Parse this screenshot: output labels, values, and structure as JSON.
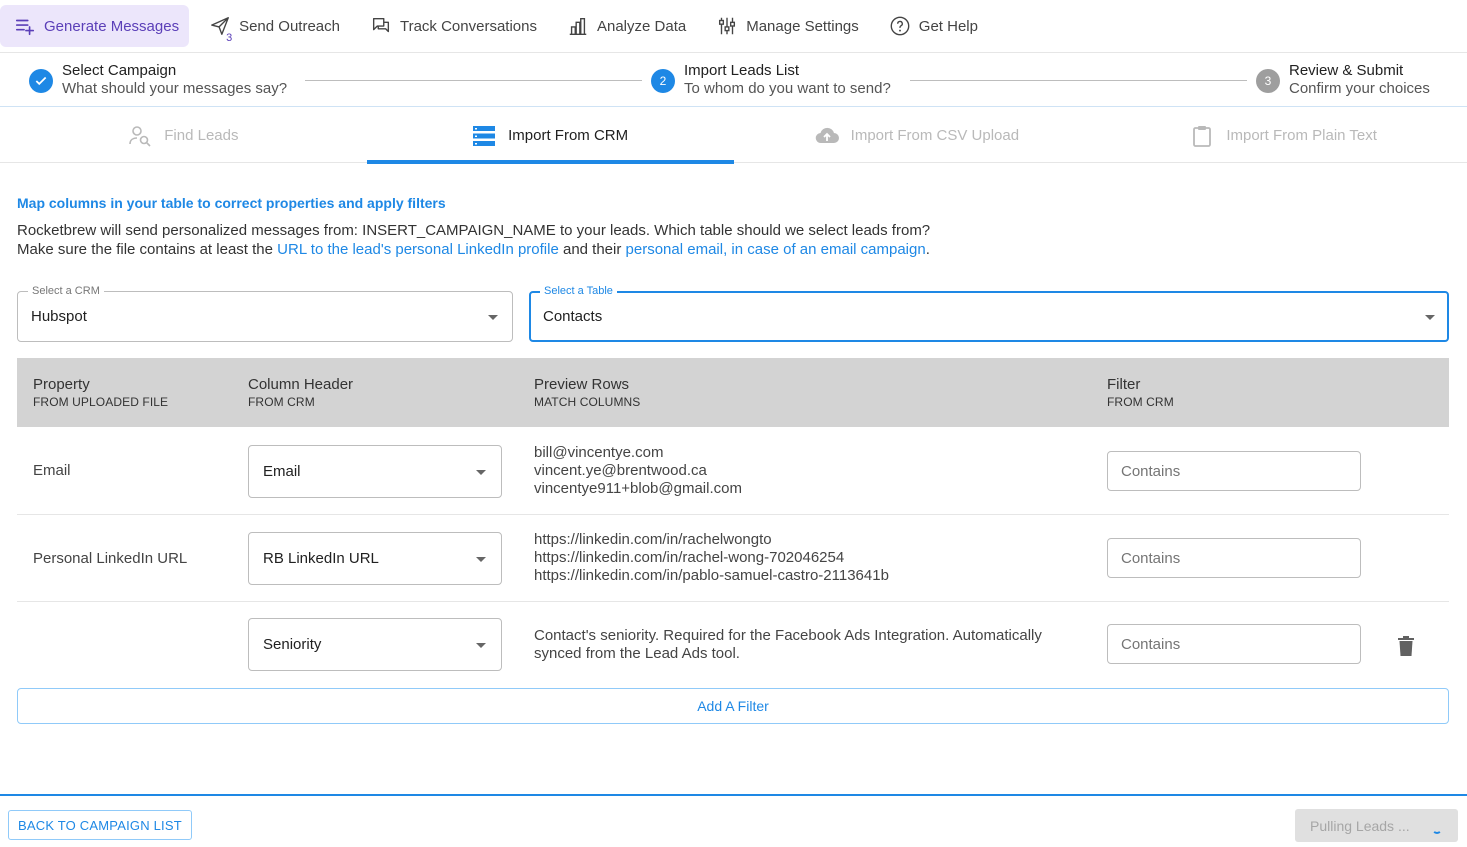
{
  "nav": {
    "items": [
      {
        "label": "Generate Messages",
        "icon": "playlist-add-icon"
      },
      {
        "label": "Send Outreach",
        "icon": "send-icon",
        "badge": "3"
      },
      {
        "label": "Track Conversations",
        "icon": "chat-icon"
      },
      {
        "label": "Analyze Data",
        "icon": "bar-chart-icon"
      },
      {
        "label": "Manage Settings",
        "icon": "sliders-icon"
      },
      {
        "label": "Get Help",
        "icon": "help-icon"
      }
    ]
  },
  "stepper": {
    "steps": [
      {
        "number": "",
        "title": "Select Campaign",
        "subtitle": "What should your messages say?",
        "state": "done"
      },
      {
        "number": "2",
        "title": "Import Leads List",
        "subtitle": "To whom do you want to send?",
        "state": "current"
      },
      {
        "number": "3",
        "title": "Review & Submit",
        "subtitle": "Confirm your choices",
        "state": "todo"
      }
    ]
  },
  "tabs": [
    {
      "label": "Find Leads",
      "icon": "person-search-icon"
    },
    {
      "label": "Import From CRM",
      "icon": "database-icon"
    },
    {
      "label": "Import From CSV Upload",
      "icon": "cloud-upload-icon"
    },
    {
      "label": "Import From Plain Text",
      "icon": "clipboard-icon"
    }
  ],
  "content": {
    "section_title": "Map columns in your table to correct properties and apply filters",
    "desc_line1": "Rocketbrew will send personalized messages from: INSERT_CAMPAIGN_NAME to your leads. Which table should we select leads from?",
    "desc_line2_a": "Make sure the file contains at least the ",
    "desc_line2_link1": "URL to the lead's personal LinkedIn profile",
    "desc_line2_b": " and their ",
    "desc_line2_link2": "personal email, in case of an email campaign",
    "desc_line2_c": "."
  },
  "crm_select": {
    "label": "Select a CRM",
    "value": "Hubspot"
  },
  "table_select": {
    "label": "Select a Table",
    "value": "Contacts"
  },
  "table": {
    "headers": [
      {
        "title": "Property",
        "sub": "FROM UPLOADED FILE"
      },
      {
        "title": "Column Header",
        "sub": "FROM CRM"
      },
      {
        "title": "Preview Rows",
        "sub": "MATCH COLUMNS"
      },
      {
        "title": "Filter",
        "sub": "FROM CRM"
      }
    ],
    "rows": [
      {
        "property": "Email",
        "column": "Email",
        "preview": [
          "bill@vincentye.com",
          "vincent.ye@brentwood.ca",
          "vincentye911+blob@gmail.com"
        ],
        "filter_placeholder": "Contains"
      },
      {
        "property": "Personal LinkedIn URL",
        "column": "RB LinkedIn URL",
        "preview": [
          "https://linkedin.com/in/rachelwongto",
          "https://linkedin.com/in/rachel-wong-702046254",
          "https://linkedin.com/in/pablo-samuel-castro-2113641b"
        ],
        "filter_placeholder": "Contains"
      },
      {
        "property": "",
        "column": "Seniority",
        "preview": [
          "Contact's seniority. Required for the Facebook Ads Integration. Automatically",
          "synced from the Lead Ads tool."
        ],
        "filter_placeholder": "Contains"
      }
    ]
  },
  "add_filter_label": "Add A Filter",
  "footer": {
    "back_label": "BACK TO CAMPAIGN LIST",
    "pull_label": "Pulling Leads ..."
  },
  "colors": {
    "accent": "#1e88e5",
    "nav_active_bg": "#ece6fb",
    "nav_active_text": "#5b3fb8",
    "table_header_bg": "#d3d3d3"
  }
}
